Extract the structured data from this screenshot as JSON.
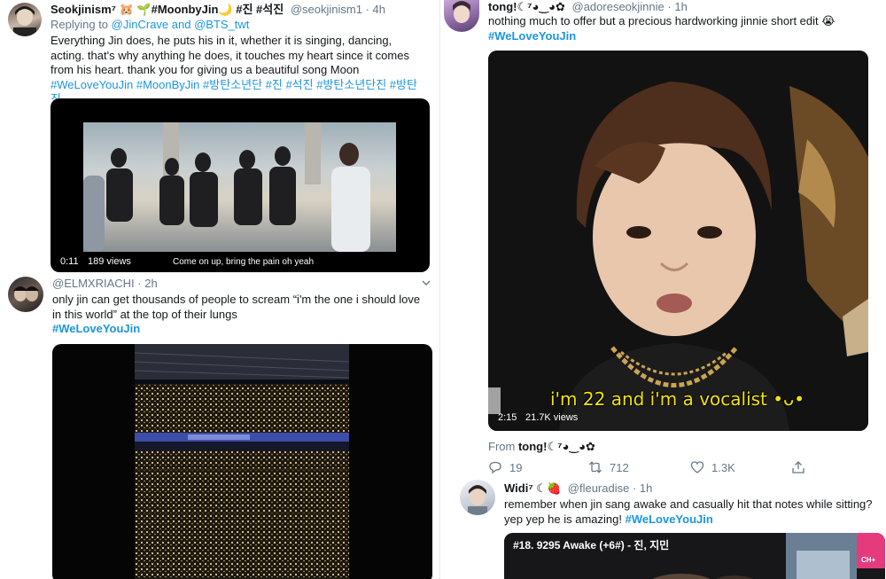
{
  "tweets": [
    {
      "author_name": "Seokjinism⁷ 🐹 🌱#MoonbyJin🌙 #진 #석진",
      "handle": "@seokjinism1",
      "time": "4h",
      "replying_prefix": "Replying to",
      "replying_to": "@JinCrave and @BTS_twt",
      "text": "Everything Jin does, he puts his in it, whether it is singing, dancing, acting. that's why anything he does, it touches my heart since it comes from his heart. thank you for giving us a beautiful song Moon",
      "hashtags": "#WeLoveYouJin #MoonByJin #방탄소년단 #진 #석진 #방탄소년단진 #방탄진",
      "video_time": "0:11",
      "video_views": "189 views",
      "video_subtitle": "Come on up, bring the pain oh yeah"
    },
    {
      "author_name": "",
      "handle": "@ELMXRIACHI",
      "time": "2h",
      "text": "only jin can get thousands of people to scream “i'm the one i should love in this world” at the top of their lungs",
      "hashtag": "#WeLoveYouJin"
    },
    {
      "author_name": "tong!☾⁷◕‿◕✿",
      "handle": "@adoreseokjinnie",
      "time": "1h",
      "text": "nothing much to offer but a precious hardworking jinnie short edit 😭",
      "hashtag": "#WeLoveYouJin",
      "video_caption": "i'm 22 and i'm a vocalist •ᴗ•",
      "video_time": "2:15",
      "video_views": "21.7K views",
      "from_label": "From",
      "from_name": "tong!☾⁷◕‿◕✿",
      "replies": "19",
      "retweets": "712",
      "likes": "1.3K"
    },
    {
      "author_name": "Widi⁷ ☾🍓",
      "handle": "@fleuradise",
      "time": "1h",
      "text": "remember when jin sang awake and casually hit that notes while sitting? yep yep he is amazing!",
      "hashtag": "#WeLoveYouJin",
      "video_title": "#18. 9295 Awake (+6#) - 진, 지민",
      "video_logo": "CH+"
    }
  ],
  "colors": {
    "link": "#1b95e0",
    "text": "#14171a",
    "meta": "#657786"
  }
}
